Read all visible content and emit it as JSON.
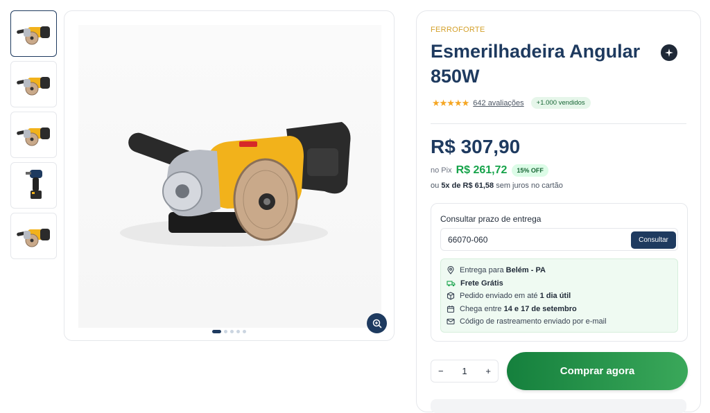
{
  "product": {
    "brand": "FERROFORTE",
    "title": "Esmerilhadeira Angular 850W",
    "stars": "★★★★★",
    "reviews": "642 avaliações",
    "sold": "+1.000 vendidos",
    "price": "R$ 307,90",
    "pix_label": "no Pix",
    "pix_price": "R$ 261,72",
    "discount": "15% OFF",
    "installment_prefix": "ou",
    "installment_value": "5x de R$ 61,58",
    "installment_suffix": "sem juros no cartão"
  },
  "delivery": {
    "title": "Consultar prazo de entrega",
    "cep_value": "66070-060",
    "button": "Consultar",
    "rows": [
      {
        "icon": "map-pin-icon",
        "text": "Entrega para",
        "bold": "Belém - PA"
      },
      {
        "icon": "truck-icon",
        "text": "",
        "bold": "Frete Grátis"
      },
      {
        "icon": "package-icon",
        "text": "Pedido enviado em até",
        "bold": "1 dia útil"
      },
      {
        "icon": "calendar-icon",
        "text": "Chega entre",
        "bold": "14 e 17 de setembro"
      },
      {
        "icon": "mail-icon",
        "text": "Código de rastreamento enviado por e-mail",
        "bold": ""
      }
    ]
  },
  "purchase": {
    "quantity": "1",
    "minus": "−",
    "plus": "+",
    "buy_label": "Comprar agora"
  },
  "gallery": {
    "thumbnails": [
      "angle-grinder",
      "angle-grinder",
      "angle-grinder",
      "cordless-drill",
      "angle-grinder"
    ],
    "active_index": 0,
    "dots": 5,
    "active_dot": 0
  },
  "colors": {
    "navy": "#1e3a5f",
    "green": "#16a34a",
    "gold": "#d4a02a"
  }
}
